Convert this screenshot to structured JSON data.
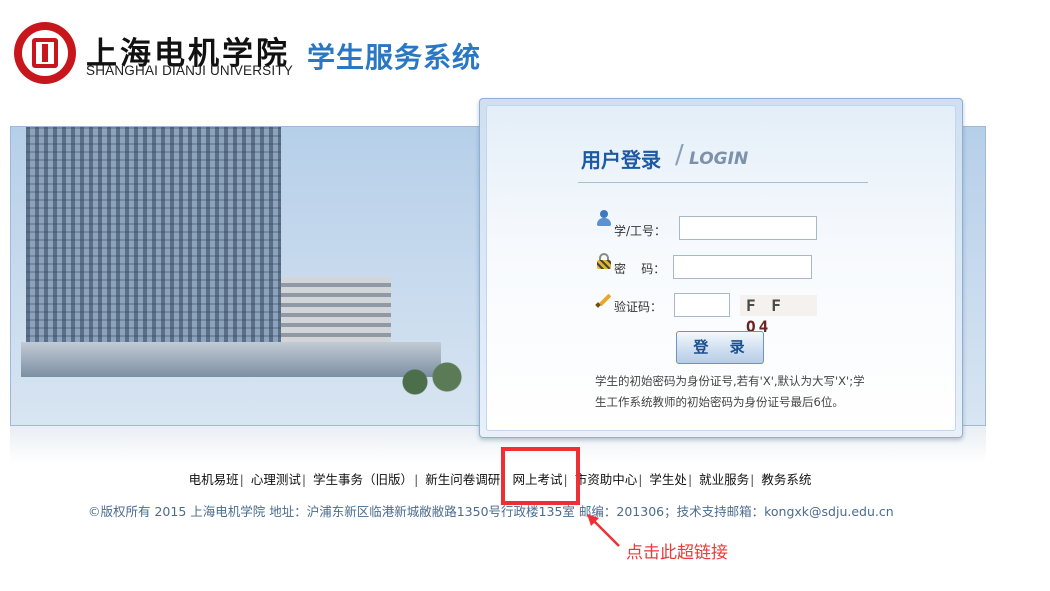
{
  "header": {
    "university_cn": "上海电机学院",
    "university_en": "SHANGHAI DIANJI UNIVERSITY",
    "system_title": "学生服务系统"
  },
  "login": {
    "title": "用户登录",
    "slash": "/",
    "subtitle": "LOGIN",
    "user_label": "学/工号：",
    "password_label": "密    码：",
    "captcha_label": "验证码：",
    "captcha_text_1": "F F ",
    "captcha_text_2": "Q4",
    "submit_label": "登 录",
    "hint": "学生的初始密码为身份证号,若有'X',默认为大写'X';学生工作系统教师的初始密码为身份证号最后6位。",
    "user_value": "",
    "password_value": "",
    "captcha_value": "",
    "icons": [
      "user-icon",
      "lock-icon",
      "pencil-icon"
    ]
  },
  "nav": {
    "items": [
      "电机易班",
      "心理测试",
      "学生事务（旧版）",
      "新生问卷调研",
      "网上考试",
      "市资助中心",
      "学生处",
      "就业服务",
      "教务系统"
    ],
    "separator": "|"
  },
  "footer": {
    "copyright": "©版权所有  2015 上海电机学院  地址：沪浦东新区临港新城敝敝路1350号行政楼135室  邮编：201306；技术支持邮箱：kongxk@sdju.edu.cn"
  },
  "annotation": {
    "text": "点击此超链接",
    "color": "#ea3a3c"
  }
}
